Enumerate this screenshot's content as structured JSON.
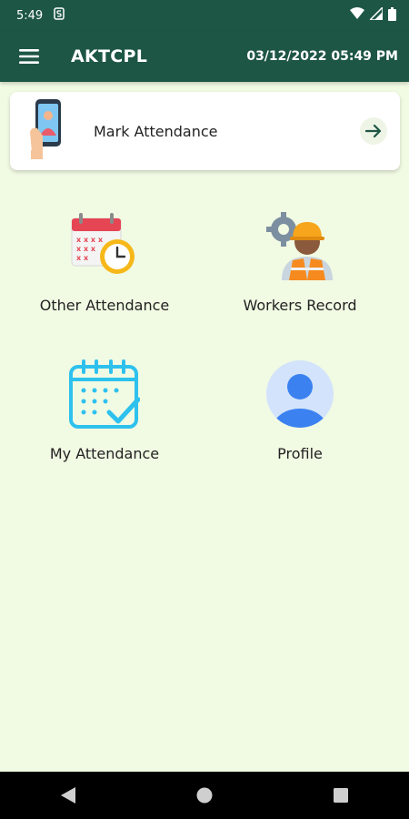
{
  "status_bar": {
    "time": "5:49",
    "icons": [
      "notification-s-icon",
      "wifi-icon",
      "signal-icon",
      "battery-icon"
    ]
  },
  "app_bar": {
    "title": "AKTCPL",
    "datetime": "03/12/2022 05:49 PM",
    "color": "#1e5645"
  },
  "mark_attendance": {
    "label": "Mark Attendance",
    "icon": "phone-user-icon",
    "action_icon": "arrow-right-icon"
  },
  "tiles": [
    {
      "label": "Other Attendance",
      "icon": "calendar-clock-icon"
    },
    {
      "label": "Workers Record",
      "icon": "worker-gear-icon"
    },
    {
      "label": "My Attendance",
      "icon": "calendar-check-icon"
    },
    {
      "label": "Profile",
      "icon": "profile-avatar-icon"
    }
  ],
  "nav_bar": {
    "buttons": [
      "back-icon",
      "home-icon",
      "recents-icon"
    ]
  },
  "colors": {
    "background": "#f1fae3",
    "accent": "#1e5645"
  }
}
